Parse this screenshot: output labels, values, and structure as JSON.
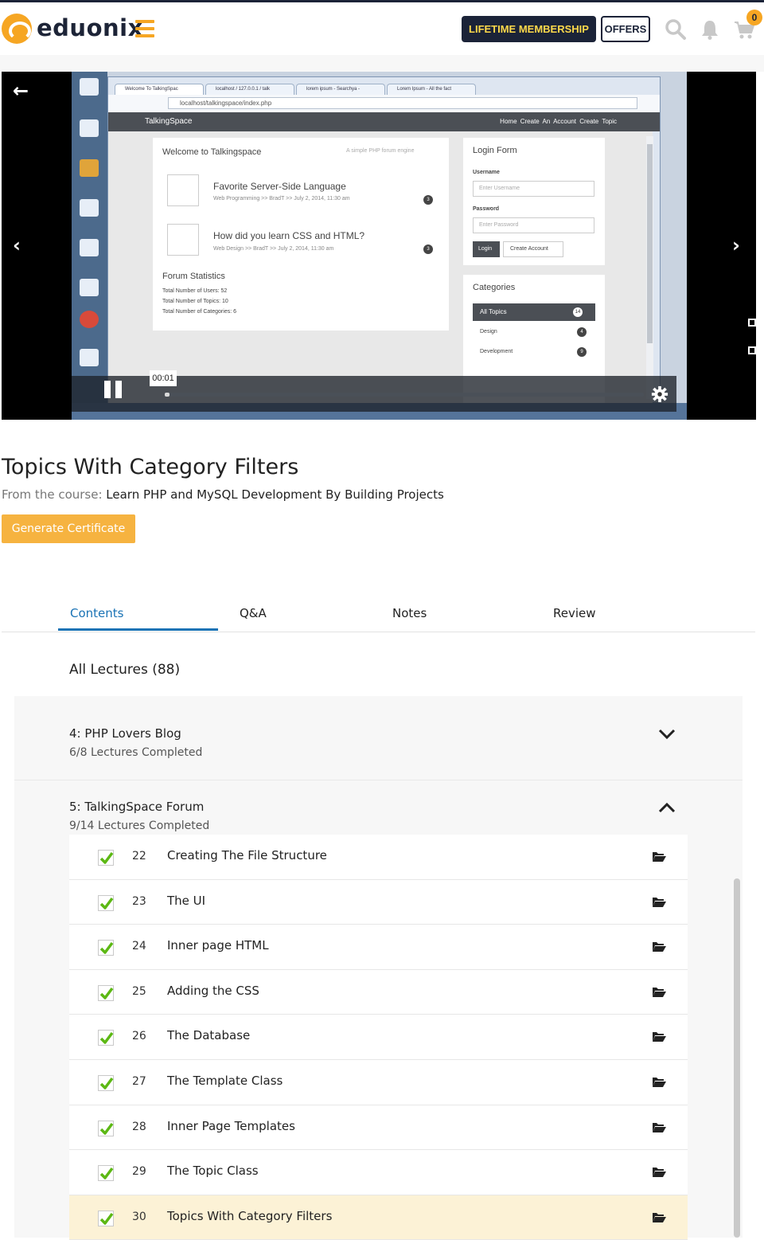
{
  "header": {
    "logo_text": "eduonix",
    "lifetime_label": "LIFETIME MEMBERSHIP",
    "offers_label": "OFFERS",
    "cart_count": "0",
    "icons": [
      "menu-icon",
      "search-icon",
      "bell-icon",
      "cart-icon"
    ],
    "colors": {
      "navy": "#1b2338",
      "accent": "#f6a623",
      "link": "#1a73b5"
    }
  },
  "player": {
    "time": "00:01",
    "progress_fraction": 0.01,
    "video_frame": {
      "tabs": [
        "Welcome To TalkingSpac",
        "localhost / 127.0.0.1 / talk",
        "lorem ipsum - Searchya -",
        "Lorem Ipsum - All the fact"
      ],
      "url": "localhost/talkingspace/index.php",
      "site_brand": "TalkingSpace",
      "site_links": "Home   Create An Account   Create Topic",
      "welcome": "Welcome to Talkingspace",
      "tagline": "A simple PHP forum engine",
      "topics": [
        {
          "title": "Favorite Server-Side Language",
          "meta": "Web Programming >> BradT >> July 2, 2014, 11:30 am",
          "count": "3"
        },
        {
          "title": "How did you learn CSS and HTML?",
          "meta": "Web Design >> BradT >> July 2, 2014, 11:30 am",
          "count": "3"
        }
      ],
      "stats_title": "Forum Statistics",
      "stats": [
        "Total Number of Users: 52",
        "Total Number of Topics: 10",
        "Total Number of Categories: 6"
      ],
      "login_title": "Login Form",
      "username_label": "Username",
      "username_placeholder": "Enter Username",
      "password_label": "Password",
      "password_placeholder": "Enter Password",
      "login_btn": "Login",
      "create_btn": "Create Account",
      "categories_title": "Categories",
      "categories": [
        {
          "name": "All Topics",
          "count": "14"
        },
        {
          "name": "Design",
          "count": "4"
        },
        {
          "name": "Development",
          "count": "9"
        }
      ]
    }
  },
  "lecture": {
    "title": "Topics With Category Filters",
    "from_label": "From the course:",
    "course_name": "Learn PHP and MySQL Development By Building Projects",
    "certificate_btn": "Generate Certificate"
  },
  "tabs": [
    "Contents",
    "Q&A",
    "Notes",
    "Review"
  ],
  "contents": {
    "all_lectures": "All Lectures (88)",
    "sections": [
      {
        "title": "4: PHP Lovers Blog",
        "progress": "6/8 Lectures Completed",
        "expanded": false
      },
      {
        "title": "5: TalkingSpace Forum",
        "progress": "9/14 Lectures Completed",
        "expanded": true
      }
    ],
    "lectures": [
      {
        "num": "22",
        "name": "Creating The File Structure",
        "done": true
      },
      {
        "num": "23",
        "name": "The UI",
        "done": true
      },
      {
        "num": "24",
        "name": "Inner page HTML",
        "done": true
      },
      {
        "num": "25",
        "name": "Adding the CSS",
        "done": true
      },
      {
        "num": "26",
        "name": "The Database",
        "done": true
      },
      {
        "num": "27",
        "name": "The Template Class",
        "done": true
      },
      {
        "num": "28",
        "name": "Inner Page Templates",
        "done": true
      },
      {
        "num": "29",
        "name": "The Topic Class",
        "done": true
      },
      {
        "num": "30",
        "name": "Topics With Category Filters",
        "done": true,
        "current": true
      }
    ]
  }
}
